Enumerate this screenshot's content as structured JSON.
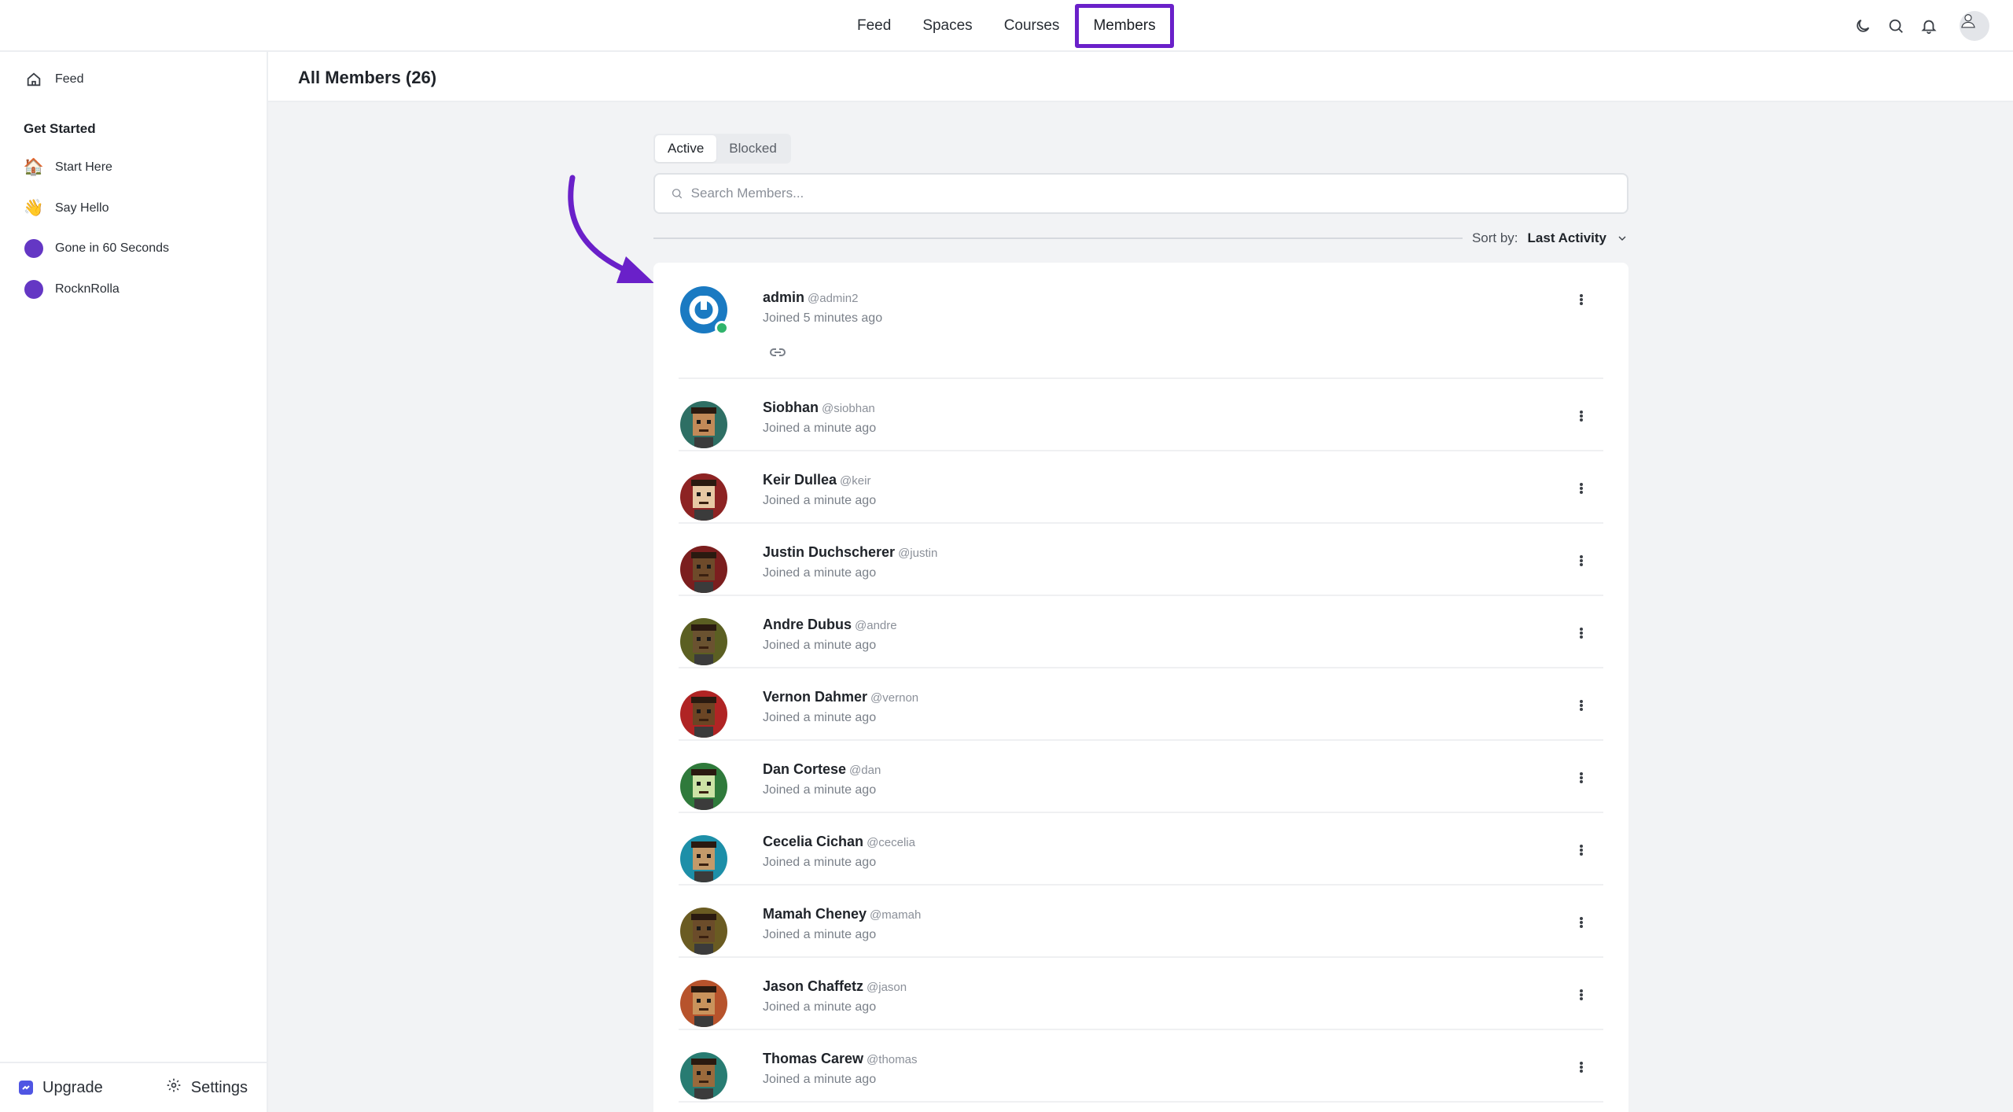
{
  "topnav": {
    "items": [
      {
        "label": "Feed"
      },
      {
        "label": "Spaces"
      },
      {
        "label": "Courses"
      },
      {
        "label": "Members",
        "active": true
      }
    ]
  },
  "top_icons": [
    "moon-icon",
    "search-icon",
    "bell-icon",
    "user-avatar"
  ],
  "sidebar": {
    "feed_label": "Feed",
    "heading": "Get Started",
    "items": [
      {
        "label": "Start Here",
        "icon": "🏠"
      },
      {
        "label": "Say Hello",
        "icon": "👋"
      },
      {
        "label": "Gone in 60 Seconds",
        "icon": "purple-dot"
      },
      {
        "label": "RocknRolla",
        "icon": "purple-dot"
      }
    ],
    "footer": {
      "upgrade_label": "Upgrade",
      "settings_label": "Settings"
    }
  },
  "page": {
    "title": "All Members (26)"
  },
  "tabs": [
    {
      "label": "Active",
      "active": true
    },
    {
      "label": "Blocked"
    }
  ],
  "search": {
    "placeholder": "Search Members..."
  },
  "sort": {
    "label": "Sort by:",
    "value": "Last Activity"
  },
  "colors": {
    "accent": "#6a20c9",
    "online": "#2fb36b",
    "space_dot": "#6437c4"
  },
  "members": [
    {
      "name": "admin",
      "handle": "@admin2",
      "joined": "Joined 5 minutes ago",
      "online": true,
      "bg": "#1a7ac2",
      "skin": "#ffffff"
    },
    {
      "name": "Siobhan",
      "handle": "@siobhan",
      "joined": "Joined a minute ago",
      "bg": "#2e6f64",
      "skin": "#c28a58"
    },
    {
      "name": "Keir Dullea",
      "handle": "@keir",
      "joined": "Joined a minute ago",
      "bg": "#8d2323",
      "skin": "#e7c9a4"
    },
    {
      "name": "Justin Duchscherer",
      "handle": "@justin",
      "joined": "Joined a minute ago",
      "bg": "#7b1e1e",
      "skin": "#6e4a2a"
    },
    {
      "name": "Andre Dubus",
      "handle": "@andre",
      "joined": "Joined a minute ago",
      "bg": "#5b5f22",
      "skin": "#6a5230"
    },
    {
      "name": "Vernon Dahmer",
      "handle": "@vernon",
      "joined": "Joined a minute ago",
      "bg": "#b02424",
      "skin": "#6b4524"
    },
    {
      "name": "Dan Cortese",
      "handle": "@dan",
      "joined": "Joined a minute ago",
      "bg": "#2f7a3b",
      "skin": "#cde3a6"
    },
    {
      "name": "Cecelia Cichan",
      "handle": "@cecelia",
      "joined": "Joined a minute ago",
      "bg": "#1d8fa8",
      "skin": "#c39a6a"
    },
    {
      "name": "Mamah Cheney",
      "handle": "@mamah",
      "joined": "Joined a minute ago",
      "bg": "#6a5b22",
      "skin": "#6b4c2a"
    },
    {
      "name": "Jason Chaffetz",
      "handle": "@jason",
      "joined": "Joined a minute ago",
      "bg": "#b7532c",
      "skin": "#c9935c"
    },
    {
      "name": "Thomas Carew",
      "handle": "@thomas",
      "joined": "Joined a minute ago",
      "bg": "#287c72",
      "skin": "#9a6a3c"
    }
  ]
}
